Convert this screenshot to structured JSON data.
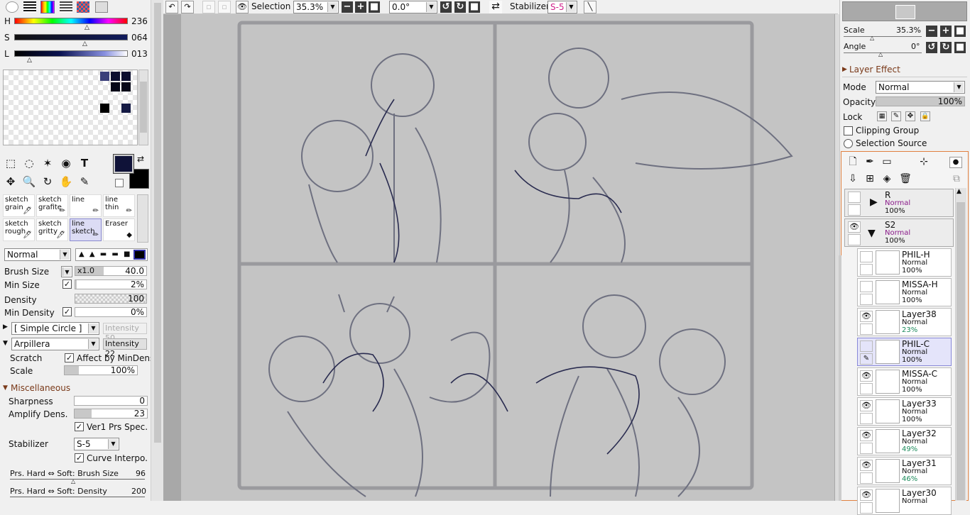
{
  "color": {
    "h_label": "H",
    "h_value": "236",
    "s_label": "S",
    "s_value": "064",
    "l_label": "L",
    "l_value": "013",
    "primary": "#0f1238",
    "secondary": "#000000"
  },
  "brushes": [
    {
      "name": "sketch grain"
    },
    {
      "name": "sketch grafite"
    },
    {
      "name": "line"
    },
    {
      "name": "line thin"
    },
    {
      "name": "sketch rough"
    },
    {
      "name": "sketch gritty"
    },
    {
      "name": "line sketch"
    },
    {
      "name": "Eraser"
    }
  ],
  "brush_settings": {
    "blend_mode": "Normal",
    "brush_size_label": "Brush Size",
    "size_mult": "x1.0",
    "brush_size": "40.0",
    "min_size_label": "Min Size",
    "min_size": "2%",
    "density_label": "Density",
    "density": "100",
    "min_density_label": "Min Density",
    "min_density": "0%",
    "shape": "[ Simple Circle ]",
    "shape_intensity": "Intensity 50",
    "texture": "Arpillera",
    "texture_intensity": "Intensity 22",
    "scratch_label": "Scratch",
    "affect_label": "Affect by MinDens",
    "scale_label": "Scale",
    "scale": "100%"
  },
  "misc": {
    "header": "Miscellaneous",
    "sharpness_label": "Sharpness",
    "sharpness": "0",
    "amplify_label": "Amplify Dens.",
    "amplify": "23",
    "ver1_label": "Ver1 Prs Spec.",
    "stabilizer_label": "Stabilizer",
    "stabilizer": "S-5",
    "curve_label": "Curve Interpo.",
    "prs_size_label": "Prs. Hard ⇔ Soft: Brush Size",
    "prs_size": "96",
    "prs_density_label": "Prs. Hard ⇔ Soft: Density",
    "prs_density": "200"
  },
  "toolbar": {
    "selection_label": "Selection",
    "zoom": "35.3%",
    "angle": "0.0°",
    "stabilizer_label": "Stabilizer",
    "stabilizer": "S-5"
  },
  "navigator": {
    "scale_label": "Scale",
    "scale": "35.3%",
    "angle_label": "Angle",
    "angle": "0°"
  },
  "layer_panel": {
    "effect_header": "Layer Effect",
    "mode_label": "Mode",
    "mode": "Normal",
    "opacity_label": "Opacity",
    "opacity": "100%",
    "lock_label": "Lock",
    "clipping_label": "Clipping Group",
    "selection_source_label": "Selection Source"
  },
  "groups": [
    {
      "name": "R",
      "mode": "Normal",
      "opacity": "100%"
    },
    {
      "name": "S2",
      "mode": "Normal",
      "opacity": "100%"
    }
  ],
  "layers": [
    {
      "name": "PHIL-H",
      "mode": "Normal",
      "opacity": "100%",
      "visible": false
    },
    {
      "name": "MISSA-H",
      "mode": "Normal",
      "opacity": "100%",
      "visible": false
    },
    {
      "name": "Layer38",
      "mode": "Normal",
      "opacity": "23%",
      "visible": true
    },
    {
      "name": "PHIL-C",
      "mode": "Normal",
      "opacity": "100%",
      "visible": false
    },
    {
      "name": "MISSA-C",
      "mode": "Normal",
      "opacity": "100%",
      "visible": true
    },
    {
      "name": "Layer33",
      "mode": "Normal",
      "opacity": "100%",
      "visible": true
    },
    {
      "name": "Layer32",
      "mode": "Normal",
      "opacity": "49%",
      "visible": true
    },
    {
      "name": "Layer31",
      "mode": "Normal",
      "opacity": "46%",
      "visible": true
    },
    {
      "name": "Layer30",
      "mode": "Normal",
      "opacity": "",
      "visible": true
    }
  ]
}
